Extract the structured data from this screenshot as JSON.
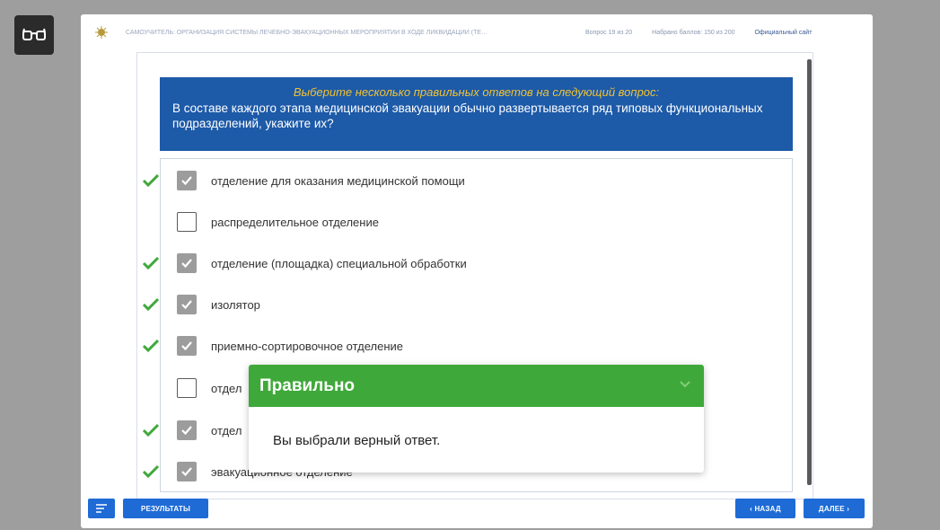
{
  "topbar": {
    "title": "САМОУЧИТЕЛЬ: ОРГАНИЗАЦИЯ СИСТЕМЫ ЛЕЧЕБНО-ЭВАКУАЦИОННЫХ МЕРОПРИЯТИЙ В ХОДЕ ЛИКВИДАЦИИ (ТЕ…",
    "question_counter": "Вопрос 19 из 20",
    "score": "Набрано баллов: 150 из 200",
    "official_site": "Официальный сайт"
  },
  "question": {
    "instruction": "Выберите несколько правильных ответов на следующий вопрос:",
    "text": "В составе каждого этапа медицинской эвакуации обычно развертывается ряд типовых функциональных подразделений, укажите их?"
  },
  "answers": [
    {
      "label": "отделение для оказания медицинской помощи",
      "checked": true,
      "correct": true
    },
    {
      "label": "распределительное отделение",
      "checked": false,
      "correct": false
    },
    {
      "label": "отделение (площадка) специальной обработки",
      "checked": true,
      "correct": true
    },
    {
      "label": "изолятор",
      "checked": true,
      "correct": true
    },
    {
      "label": "приемно-сортировочное отделение",
      "checked": true,
      "correct": true
    },
    {
      "label": "отдел",
      "checked": false,
      "correct": false
    },
    {
      "label": "отдел",
      "checked": true,
      "correct": true
    },
    {
      "label": "эвакуационное отделение",
      "checked": true,
      "correct": true
    }
  ],
  "popup": {
    "title": "Правильно",
    "message": "Вы выбрали верный ответ."
  },
  "footer": {
    "results_label": "РЕЗУЛЬТАТЫ",
    "back_label": "‹ НАЗАД",
    "next_label": "ДАЛЕЕ ›"
  },
  "icons": {
    "glasses": "glasses-icon",
    "logo": "emblem-icon",
    "menu": "menu-icon",
    "tick": "checkmark-icon",
    "chevron": "chevron-down-icon"
  },
  "colors": {
    "accent": "#1e6bd6",
    "question_bg": "#1d5aa8",
    "instruction": "#f1c232",
    "correct": "#3fa83a"
  }
}
